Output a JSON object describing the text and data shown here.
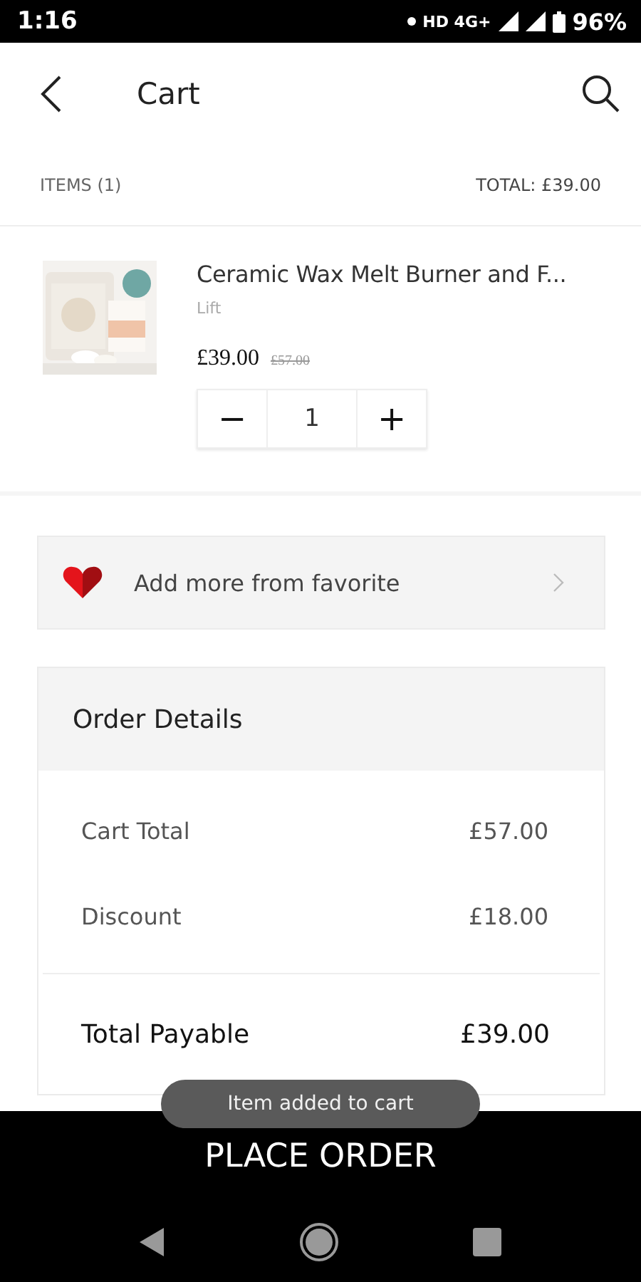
{
  "status_bar": {
    "time": "1:16",
    "indicators": "HD 4G+",
    "battery": "96%"
  },
  "header": {
    "title": "Cart"
  },
  "summary": {
    "items": "ITEMS (1)",
    "total": "TOTAL: £39.00"
  },
  "cart_items": [
    {
      "name": "Ceramic Wax Melt Burner and F...",
      "brand": "Lift",
      "price": "£39.00",
      "old_price": "£57.00",
      "quantity": "1",
      "decrement": "−",
      "increment": "+"
    }
  ],
  "favorite_link": {
    "label": "Add more from favorite"
  },
  "order_details": {
    "title": "Order Details",
    "rows": [
      {
        "label": "Cart Total",
        "value": "£57.00"
      },
      {
        "label": "Discount",
        "value": "£18.00"
      }
    ],
    "total": {
      "label": "Total Payable",
      "value": "£39.00"
    }
  },
  "toast": "Item added to cart",
  "place_order": "PLACE ORDER"
}
